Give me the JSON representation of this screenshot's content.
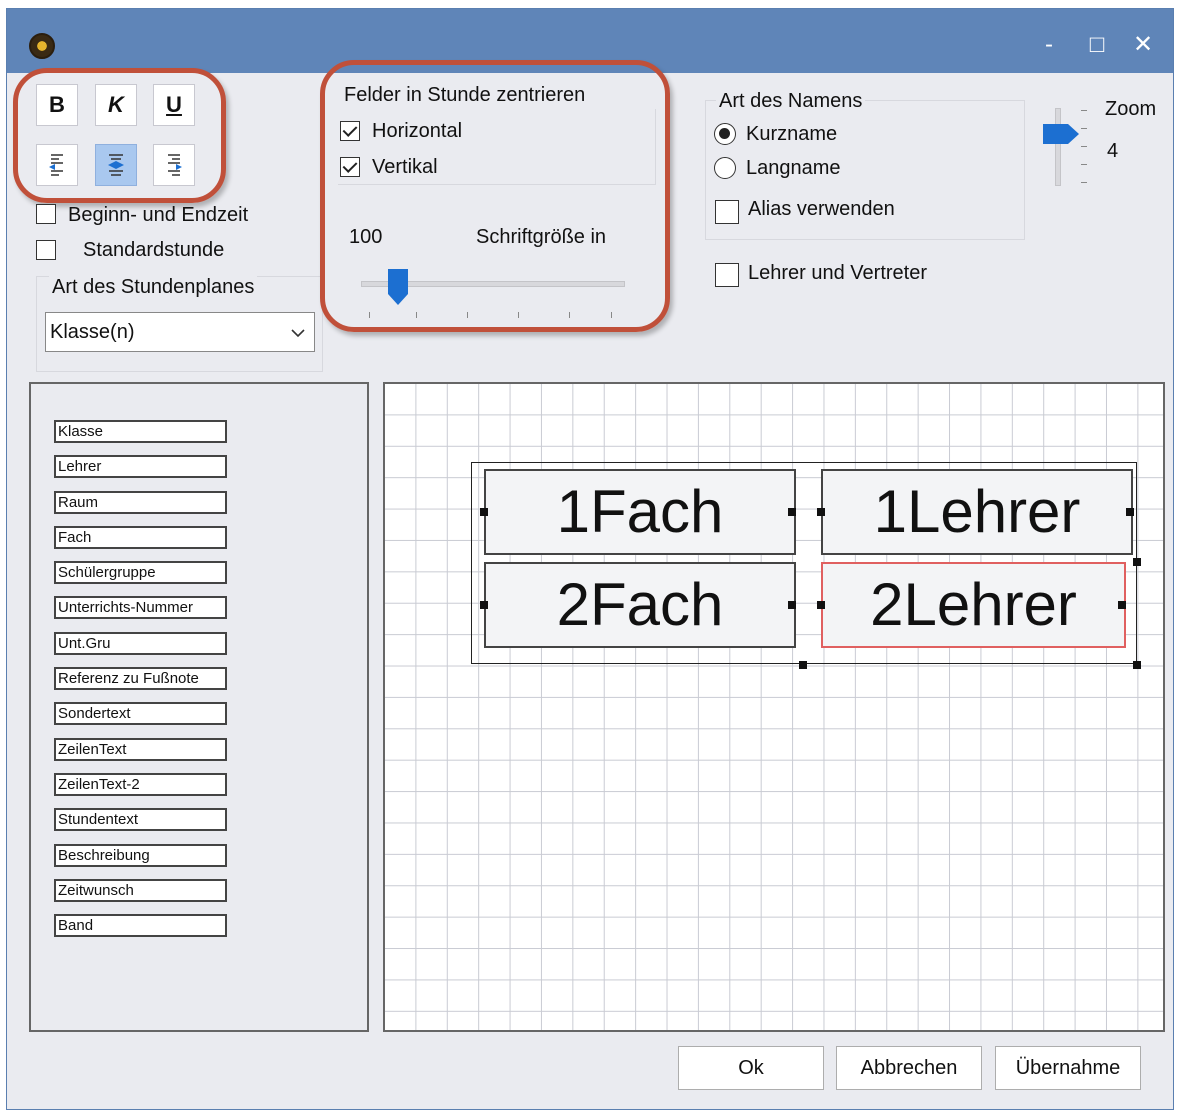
{
  "window": {
    "icon": "clock-app-icon",
    "minimize_label": "-",
    "maximize_label": "□",
    "close_label": "✕"
  },
  "format_buttons": {
    "bold": "B",
    "italic": "K",
    "underline": "U",
    "align_left_icon": "align-left-icon",
    "align_center_icon": "align-center-icon",
    "align_right_icon": "align-right-icon"
  },
  "options": {
    "begin_end_time": "Beginn- und Endzeit",
    "standard_hour": "Standardstunde"
  },
  "plan_type": {
    "label": "Art des Stundenplanes",
    "selected": "Klasse(n)"
  },
  "center_fields": {
    "title": "Felder in Stunde zentrieren",
    "horizontal": "Horizontal",
    "vertical": "Vertikal",
    "font_size_value": "100",
    "font_size_label": "Schriftgröße in"
  },
  "name_type": {
    "title": "Art des Namens",
    "short_name": "Kurzname",
    "long_name": "Langname",
    "use_alias": "Alias verwenden",
    "teacher_substitute": "Lehrer und Vertreter"
  },
  "zoom": {
    "label": "Zoom",
    "value": "4"
  },
  "fields": [
    "Klasse",
    "Lehrer",
    "Raum",
    "Fach",
    "Schülergruppe",
    "Unterrichts-Nummer",
    "Unt.Gru",
    "Referenz zu Fußnote",
    "Sondertext",
    "ZeilenText",
    "ZeilenText-2",
    "Stundentext",
    "Beschreibung",
    "Zeitwunsch",
    "Band"
  ],
  "preview": {
    "cells": [
      "1Fach",
      "1Lehrer",
      "2Fach",
      "2Lehrer"
    ]
  },
  "buttons": {
    "ok": "Ok",
    "cancel": "Abbrechen",
    "apply": "Übernahme"
  },
  "colors": {
    "titlebar": "#5f85b8",
    "highlight_ring": "#c0503a",
    "selected_field_border": "#e06060",
    "slider_accent": "#1c6fd1"
  }
}
